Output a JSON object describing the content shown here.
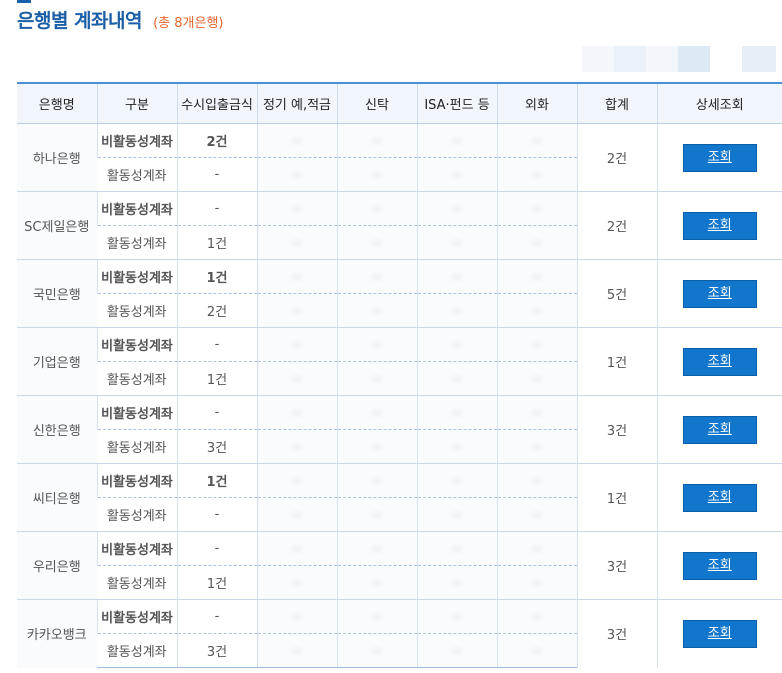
{
  "header": {
    "title": "은행별 계좌내역",
    "subtitle_prefix": "(총 ",
    "subtitle_count": "8개은행",
    "subtitle_suffix": ")"
  },
  "colors": {
    "title": "#1b5fa6",
    "accent_orange": "#e8652a",
    "link_blue": "#1a6ab5",
    "button_blue": "#1276cc",
    "header_border": "#4a8fd6"
  },
  "table": {
    "columns": [
      "은행명",
      "구분",
      "수시입출금식",
      "정기 예,적금",
      "신탁",
      "ISA·펀드 등",
      "외화",
      "합계",
      "상세조회"
    ],
    "rows": [
      {
        "bank": "하나은행",
        "inactive_label": "비활동성계좌",
        "inactive_value": "2건",
        "active_label": "활동성계좌",
        "active_value": "-",
        "total": "2건",
        "button": "조회"
      },
      {
        "bank": "SC제일은행",
        "inactive_label": "비활동성계좌",
        "inactive_value": "-",
        "active_label": "활동성계좌",
        "active_value": "1건",
        "total": "2건",
        "button": "조회"
      },
      {
        "bank": "국민은행",
        "inactive_label": "비활동성계좌",
        "inactive_value": "1건",
        "active_label": "활동성계좌",
        "active_value": "2건",
        "total": "5건",
        "button": "조회"
      },
      {
        "bank": "기업은행",
        "inactive_label": "비활동성계좌",
        "inactive_value": "-",
        "active_label": "활동성계좌",
        "active_value": "1건",
        "total": "1건",
        "button": "조회"
      },
      {
        "bank": "신한은행",
        "inactive_label": "비활동성계좌",
        "inactive_value": "-",
        "active_label": "활동성계좌",
        "active_value": "3건",
        "total": "3건",
        "button": "조회"
      },
      {
        "bank": "씨티은행",
        "inactive_label": "비활동성계좌",
        "inactive_value": "1건",
        "active_label": "활동성계좌",
        "active_value": "-",
        "total": "1건",
        "button": "조회"
      },
      {
        "bank": "우리은행",
        "inactive_label": "비활동성계좌",
        "inactive_value": "-",
        "active_label": "활동성계좌",
        "active_value": "1건",
        "total": "3건",
        "button": "조회"
      },
      {
        "bank": "카카오뱅크",
        "inactive_label": "비활동성계좌",
        "inactive_value": "-",
        "active_label": "활동성계좌",
        "active_value": "3건",
        "total": "3건",
        "button": "조회"
      }
    ]
  }
}
